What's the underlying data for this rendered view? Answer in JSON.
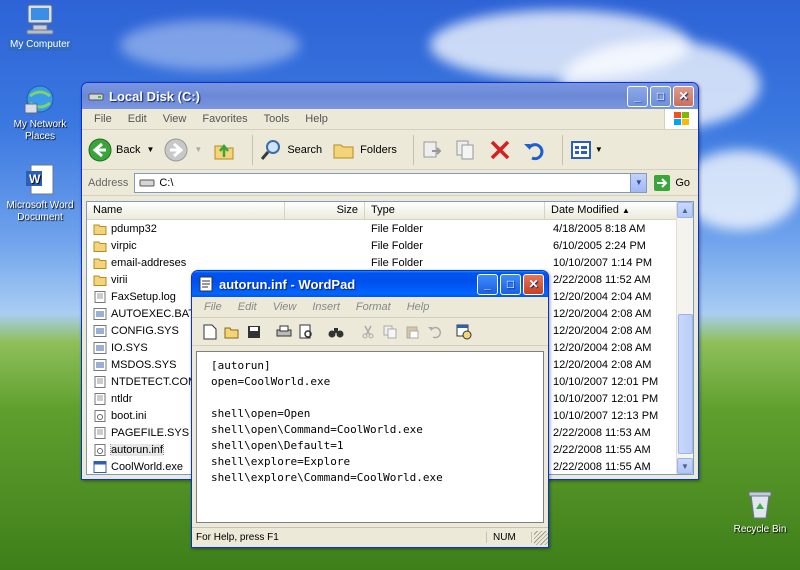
{
  "desktop": {
    "icons": [
      {
        "label": "My Computer",
        "icon": "computer-icon"
      },
      {
        "label": "My Network Places",
        "icon": "network-icon"
      },
      {
        "label": "Microsoft Word Document",
        "icon": "word-doc-icon"
      },
      {
        "label": "Recycle Bin",
        "icon": "recycle-bin-icon"
      }
    ]
  },
  "explorer": {
    "title": "Local Disk (C:)",
    "menu": [
      "File",
      "Edit",
      "View",
      "Favorites",
      "Tools",
      "Help"
    ],
    "toolbar": {
      "back": "Back",
      "search": "Search",
      "folders": "Folders"
    },
    "address": {
      "label": "Address",
      "value": "C:\\",
      "go": "Go"
    },
    "columns": [
      "Name",
      "Size",
      "Type",
      "Date Modified"
    ],
    "files": [
      {
        "name": "pdump32",
        "type": "File Folder",
        "date": "4/18/2005 8:18 AM",
        "kind": "folder"
      },
      {
        "name": "virpic",
        "type": "File Folder",
        "date": "6/10/2005 2:24 PM",
        "kind": "folder"
      },
      {
        "name": "email-addreses",
        "type": "File Folder",
        "date": "10/10/2007 1:14 PM",
        "kind": "folder"
      },
      {
        "name": "virii",
        "type": "",
        "date": "2/22/2008 11:52 AM",
        "kind": "folder"
      },
      {
        "name": "FaxSetup.log",
        "type": "",
        "date": "12/20/2004 2:04 AM",
        "kind": "text"
      },
      {
        "name": "AUTOEXEC.BAT",
        "type": "",
        "date": "12/20/2004 2:08 AM",
        "kind": "sys"
      },
      {
        "name": "CONFIG.SYS",
        "type": "",
        "date": "12/20/2004 2:08 AM",
        "kind": "sys"
      },
      {
        "name": "IO.SYS",
        "type": "",
        "date": "12/20/2004 2:08 AM",
        "kind": "sys"
      },
      {
        "name": "MSDOS.SYS",
        "type": "",
        "date": "12/20/2004 2:08 AM",
        "kind": "sys"
      },
      {
        "name": "NTDETECT.COM",
        "type": "",
        "date": "10/10/2007 12:01 PM",
        "kind": "text"
      },
      {
        "name": "ntldr",
        "type": "",
        "date": "10/10/2007 12:01 PM",
        "kind": "text"
      },
      {
        "name": "boot.ini",
        "type": "",
        "date": "10/10/2007 12:13 PM",
        "kind": "ini"
      },
      {
        "name": "PAGEFILE.SYS",
        "type": "",
        "date": "2/22/2008 11:53 AM",
        "kind": "text"
      },
      {
        "name": "autorun.inf",
        "type": "",
        "date": "2/22/2008 11:55 AM",
        "kind": "ini",
        "selected": true
      },
      {
        "name": "CoolWorld.exe",
        "type": "",
        "date": "2/22/2008 11:55 AM",
        "kind": "exe"
      }
    ]
  },
  "wordpad": {
    "title": "autorun.inf - WordPad",
    "menu": [
      "File",
      "Edit",
      "View",
      "Insert",
      "Format",
      "Help"
    ],
    "lines": [
      "[autorun]",
      "open=CoolWorld.exe",
      "",
      "shell\\open=Open",
      "shell\\open\\Command=CoolWorld.exe",
      "shell\\open\\Default=1",
      "shell\\explore=Explore",
      "shell\\explore\\Command=CoolWorld.exe"
    ],
    "status": {
      "help": "For Help, press F1",
      "num": "NUM"
    }
  }
}
